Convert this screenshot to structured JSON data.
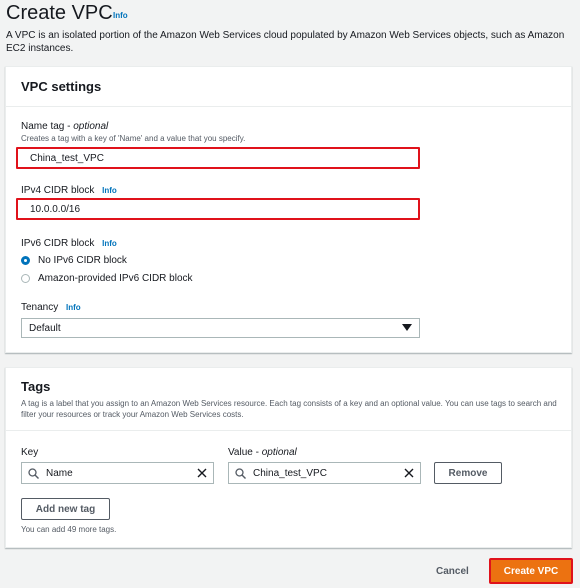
{
  "header": {
    "title": "Create VPC",
    "info": "Info",
    "description": "A VPC is an isolated portion of the Amazon Web Services cloud populated by Amazon Web Services objects, such as Amazon EC2 instances."
  },
  "vpc_settings": {
    "heading": "VPC settings",
    "name_tag": {
      "label": "Name tag -",
      "optional": "optional",
      "hint": "Creates a tag with a key of 'Name' and a value that you specify.",
      "value": "China_test_VPC"
    },
    "ipv4": {
      "label": "IPv4 CIDR block",
      "info": "Info",
      "value": "10.0.0.0/16"
    },
    "ipv6": {
      "label": "IPv6 CIDR block",
      "info": "Info",
      "options": [
        {
          "label": "No IPv6 CIDR block",
          "checked": true
        },
        {
          "label": "Amazon-provided IPv6 CIDR block",
          "checked": false
        }
      ]
    },
    "tenancy": {
      "label": "Tenancy",
      "info": "Info",
      "value": "Default"
    }
  },
  "tags": {
    "heading": "Tags",
    "description": "A tag is a label that you assign to an Amazon Web Services resource. Each tag consists of a key and an optional value. You can use tags to search and filter your resources or track your Amazon Web Services costs.",
    "key_label": "Key",
    "value_label": "Value -",
    "value_optional": "optional",
    "row": {
      "key": "Name",
      "value": "China_test_VPC"
    },
    "remove_label": "Remove",
    "add_label": "Add new tag",
    "limit_text": "You can add 49 more tags."
  },
  "footer": {
    "cancel_label": "Cancel",
    "create_label": "Create VPC"
  },
  "colors": {
    "accent_orange": "#ec7211",
    "highlight_red": "#e0121b",
    "link_blue": "#0073bb"
  }
}
